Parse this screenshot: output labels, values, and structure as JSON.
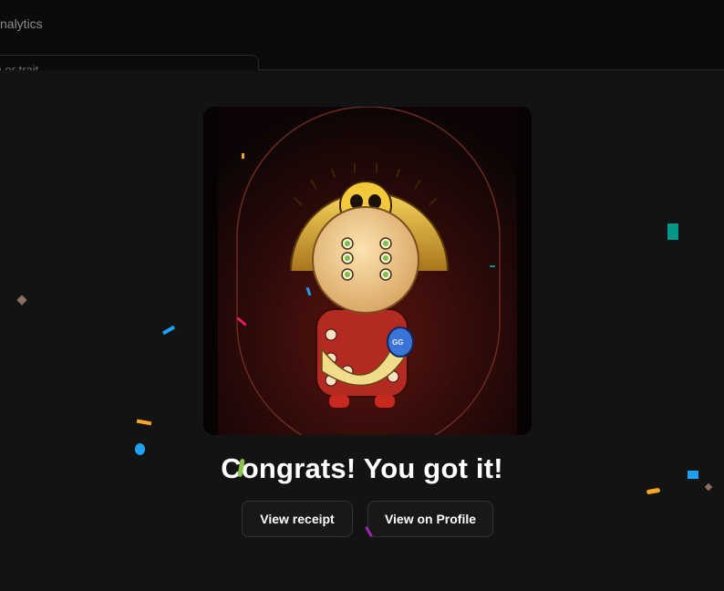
{
  "header": {
    "tab_label": "nalytics",
    "search_placeholder": "m or trait"
  },
  "modal": {
    "headline": "Congrats! You got it!",
    "buttons": {
      "receipt": "View receipt",
      "profile": "View on Profile"
    },
    "badge_text": "GG"
  },
  "colors": {
    "background": "#131313",
    "header_bg": "#0b0b0b",
    "button_bg": "#181818",
    "button_border": "#333333",
    "confetti": [
      "#f5a623",
      "#1da1f2",
      "#009688",
      "#e91e63",
      "#9c27b0",
      "#8d6e63",
      "#8bc34a"
    ]
  }
}
